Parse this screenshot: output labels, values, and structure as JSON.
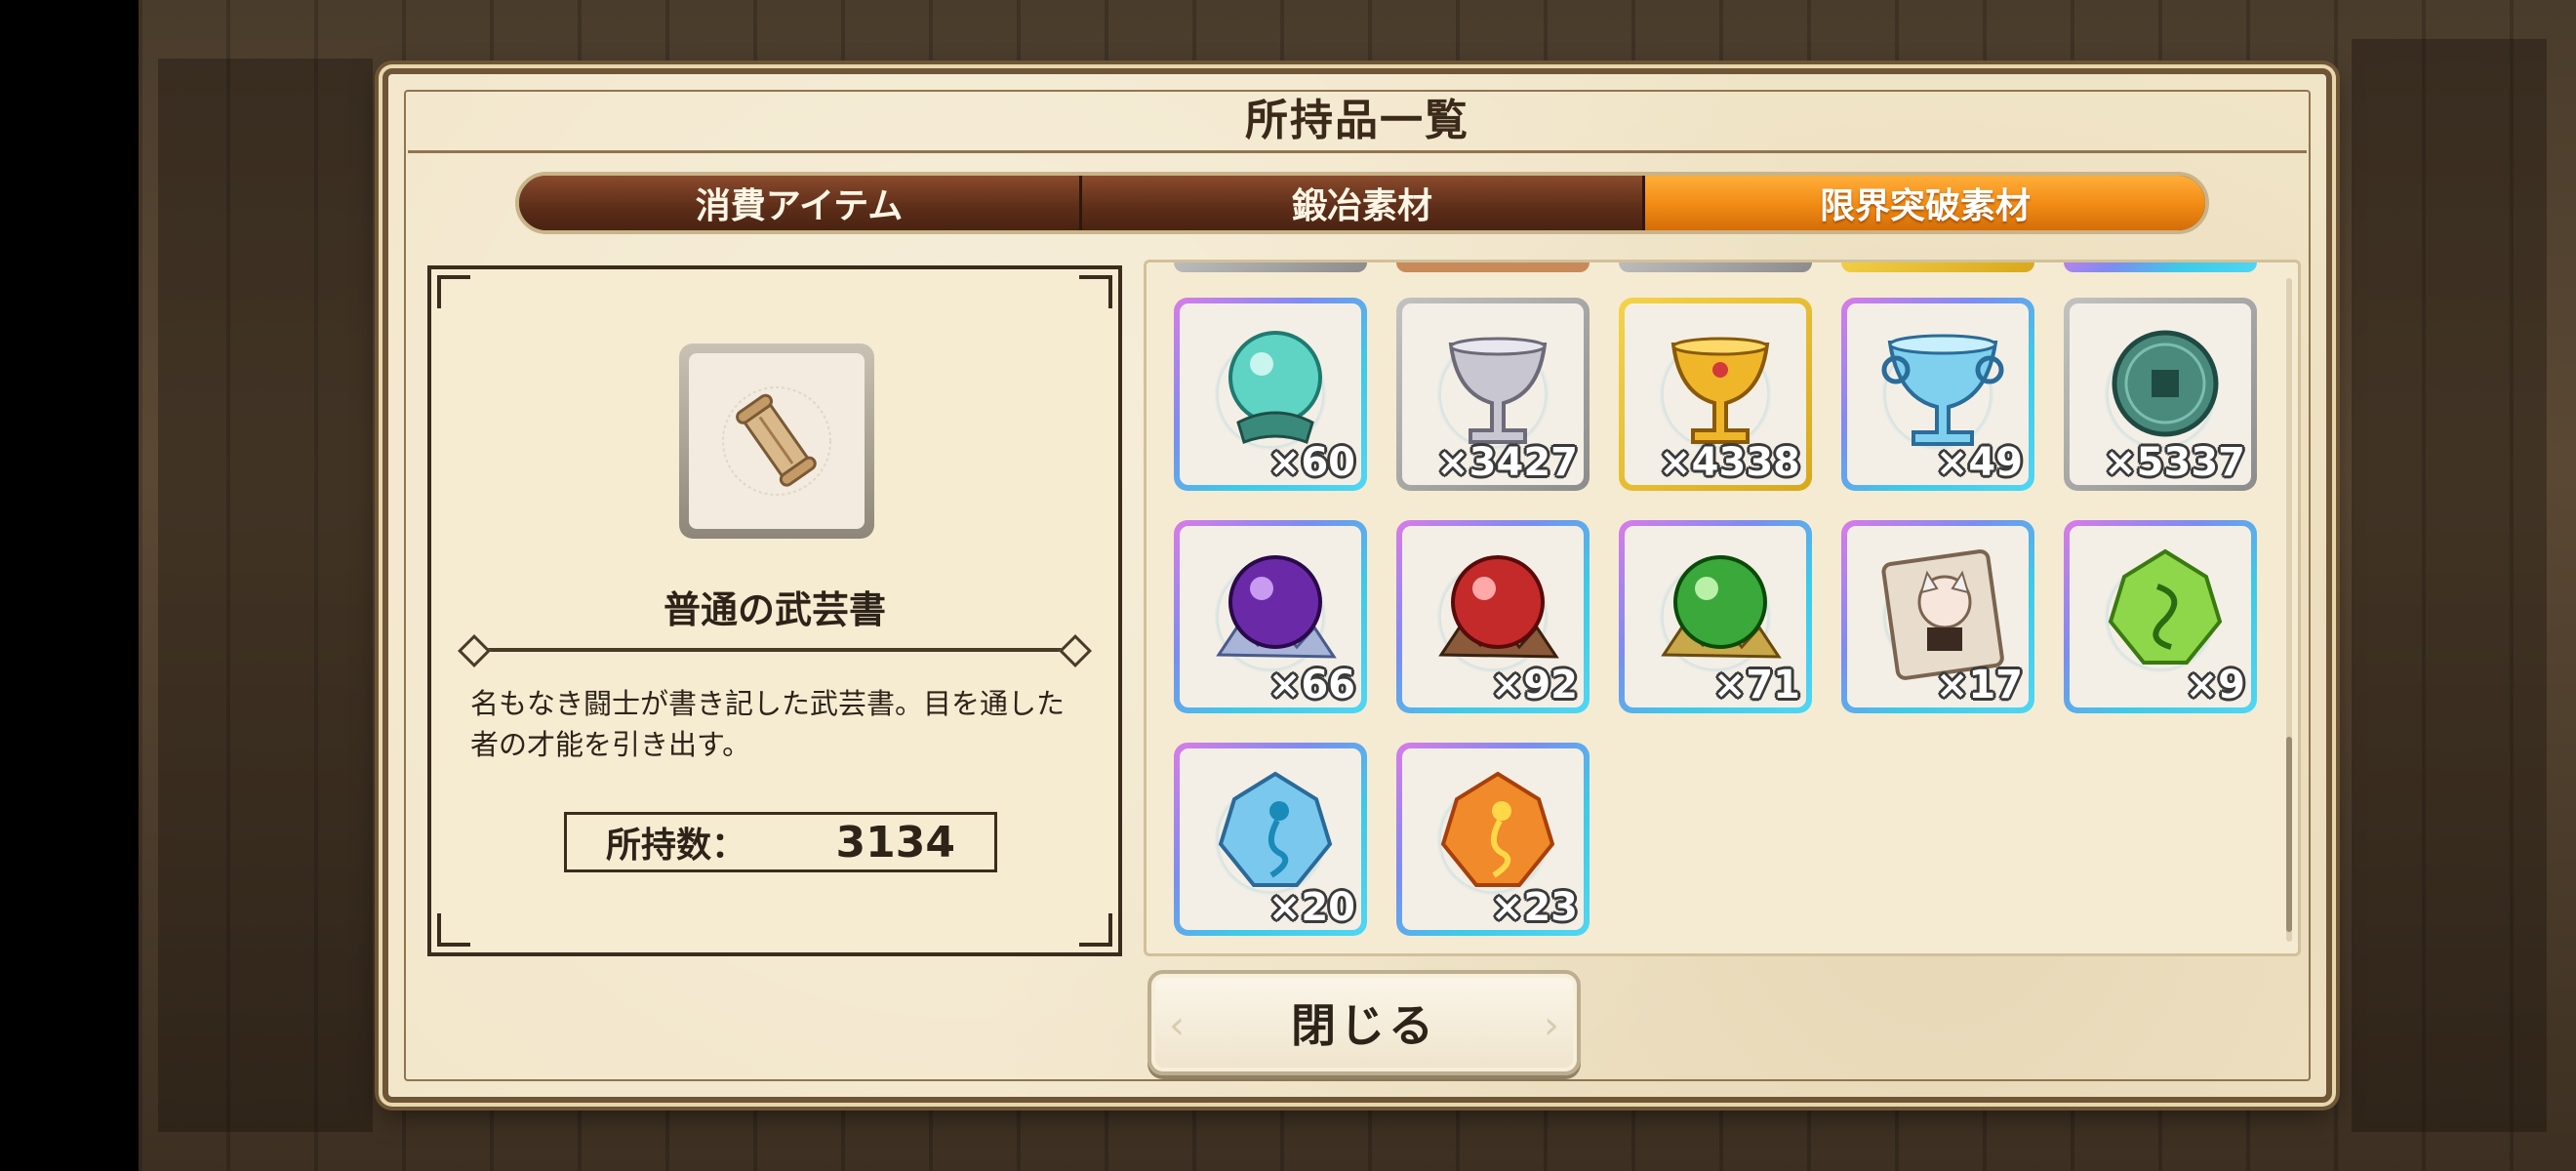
{
  "dialog": {
    "title": "所持品一覧"
  },
  "tabs": [
    {
      "label": "消費アイテム",
      "active": false
    },
    {
      "label": "鍛冶素材",
      "active": false
    },
    {
      "label": "限界突破素材",
      "active": true
    }
  ],
  "detail": {
    "icon": "scroll-icon",
    "name": "普通の武芸書",
    "description": "名もなき闘士が書き記した武芸書。目を通した者の才能を引き出す。",
    "count_label": "所持数：",
    "count_value": "3134"
  },
  "items": [
    {
      "icon": "teal-orb-icon",
      "qty": "×60"
    },
    {
      "icon": "silver-chalice-icon",
      "qty": "×3427"
    },
    {
      "icon": "gold-chalice-icon",
      "qty": "×4338"
    },
    {
      "icon": "crystal-chalice-icon",
      "qty": "×49"
    },
    {
      "icon": "jade-coin-icon",
      "qty": "×5337"
    },
    {
      "icon": "purple-gem-icon",
      "qty": "×66"
    },
    {
      "icon": "red-gem-icon",
      "qty": "×92"
    },
    {
      "icon": "green-gem-icon",
      "qty": "×71"
    },
    {
      "icon": "portrait-book-icon",
      "qty": "×17"
    },
    {
      "icon": "green-crystal-icon",
      "qty": "×9"
    },
    {
      "icon": "blue-crystal-icon",
      "qty": "×20"
    },
    {
      "icon": "orange-crystal-icon",
      "qty": "×23"
    }
  ],
  "close_button": {
    "label": "閉じる"
  },
  "colors": {
    "tab_active": "#f08a14",
    "tab_inactive": "#5c2d18",
    "panel": "#f2e6c9"
  }
}
